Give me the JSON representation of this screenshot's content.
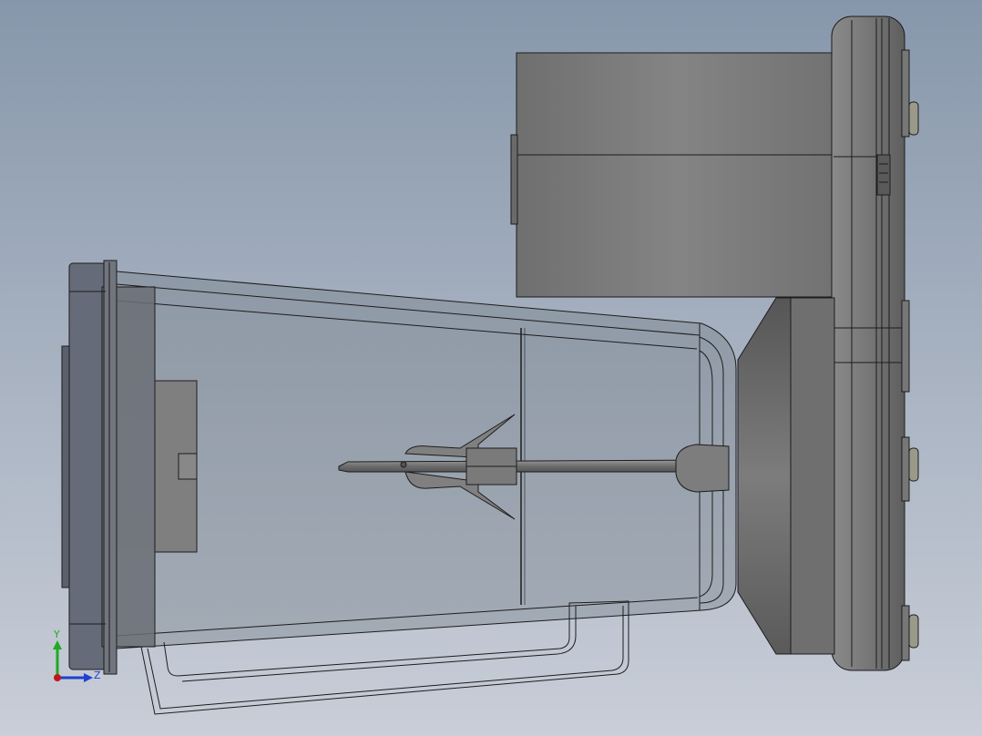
{
  "viewport": {
    "background_top": "#8797ab",
    "background_bottom": "#c9ced8"
  },
  "triad": {
    "y_label": "Y",
    "z_label": "Z",
    "y_color": "#1faa1f",
    "z_color": "#2040d0",
    "origin_color": "#c01818"
  },
  "colors": {
    "motor": "#7b7b7b",
    "motor_dark": "#6a6a6a",
    "jar_glass": "#9aa3ae",
    "lid": "#656b78",
    "outline": "#1c1c1c"
  }
}
